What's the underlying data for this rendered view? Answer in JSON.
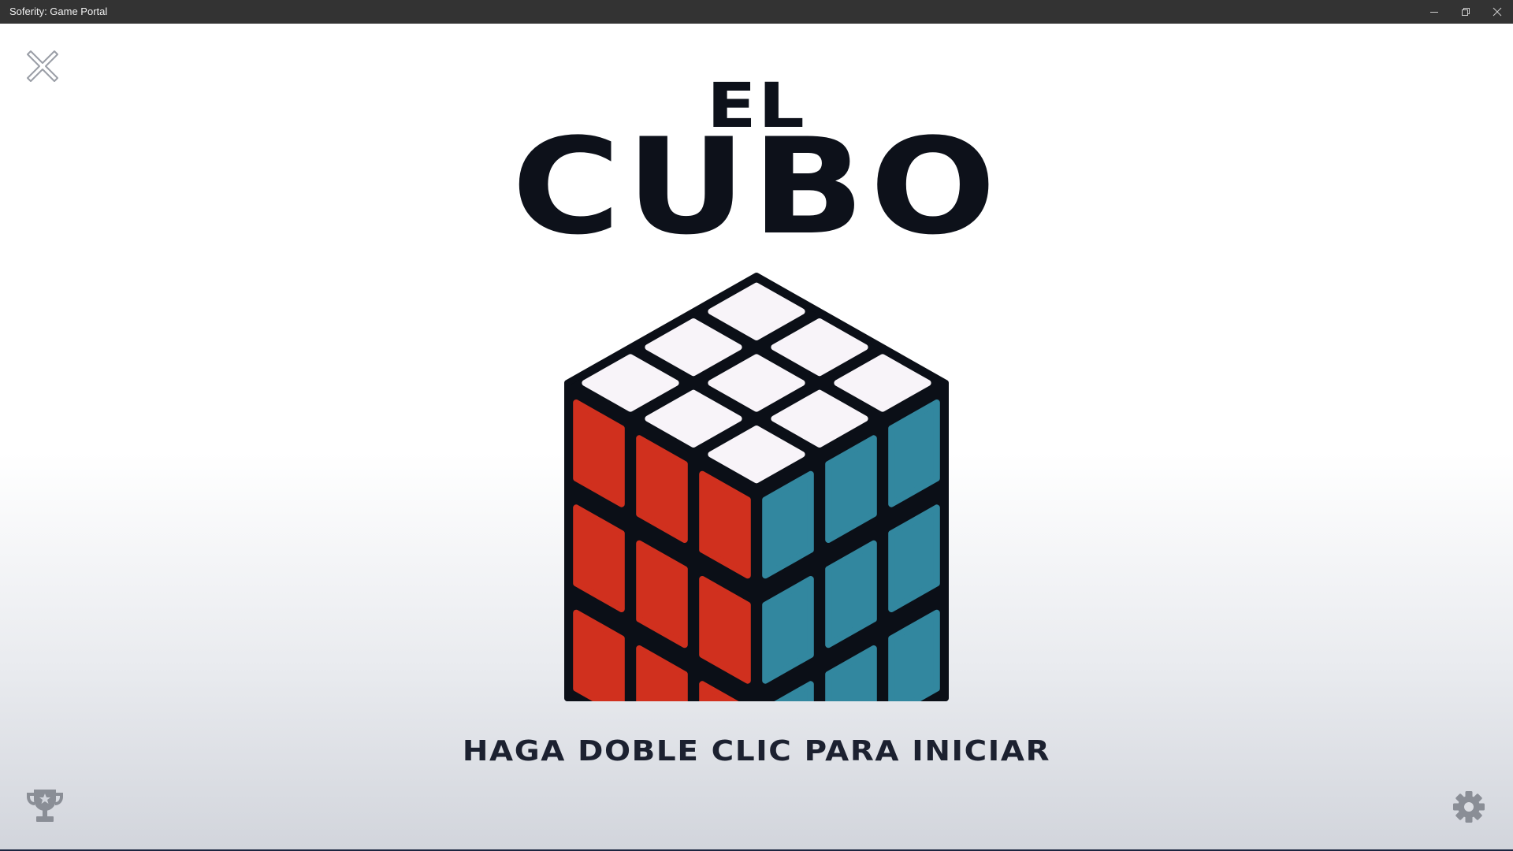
{
  "window": {
    "title": "Soferity: Game Portal",
    "controls": [
      "minimize-icon",
      "restore-icon",
      "close-icon"
    ]
  },
  "game": {
    "title_line1": "EL",
    "title_line2": "CUBO",
    "prompt": "HAGA DOBLE CLIC PARA INICIAR"
  },
  "icons": {
    "exit": "close-x-icon",
    "achievements": "trophy-icon",
    "settings": "gear-icon"
  },
  "cube": {
    "top_color": "#f8f4f9",
    "left_color": "#d0301e",
    "right_color": "#32879f",
    "body_color": "#0b0f17"
  },
  "colors": {
    "text": "#0d111a",
    "titlebar": "#333333",
    "icon_gray": "#8a8e96"
  }
}
